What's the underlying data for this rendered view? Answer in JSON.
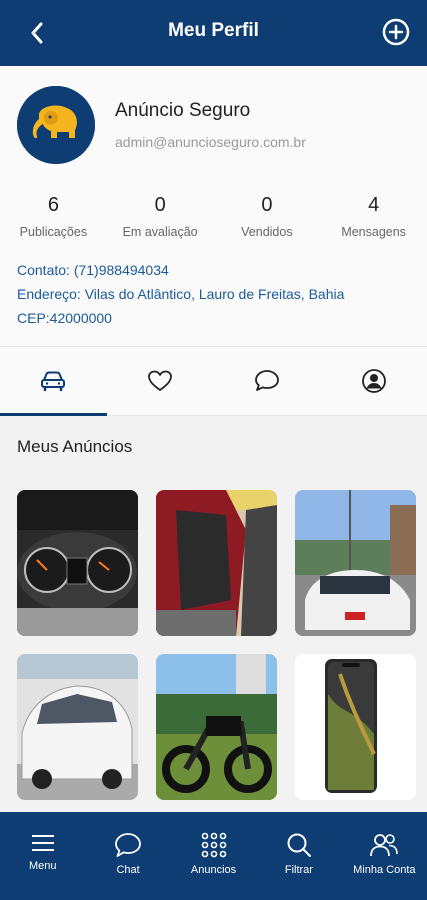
{
  "header": {
    "title": "Meu Perfil",
    "back_icon": "arrow-left-icon",
    "add_icon": "plus-circle-icon"
  },
  "profile": {
    "name": "Anúncio Seguro",
    "email": "admin@anuncioseguro.com.br",
    "stats": [
      {
        "value": "6",
        "label": "Publicações"
      },
      {
        "value": "0",
        "label": "Em avaliação"
      },
      {
        "value": "0",
        "label": "Vendidos"
      },
      {
        "value": "4",
        "label": "Mensagens"
      }
    ],
    "contact": "Contato: (71)988494034",
    "address": "Endereço: Vilas do Atlântico, Lauro de Freitas, Bahia",
    "cep": "CEP:42000000"
  },
  "tabs": [
    {
      "icon": "car-icon",
      "active": true
    },
    {
      "icon": "heart-icon",
      "active": false
    },
    {
      "icon": "chat-bubbles-icon",
      "active": false
    },
    {
      "icon": "user-circle-icon",
      "active": false
    }
  ],
  "section_title": "Meus Anúncios",
  "nav": [
    {
      "label": "Menu",
      "icon": "menu-icon"
    },
    {
      "label": "Chat",
      "icon": "chat-icon"
    },
    {
      "label": "Anuncios",
      "icon": "grid-icon"
    },
    {
      "label": "Filtrar",
      "icon": "search-icon"
    },
    {
      "label": "Minha Conta",
      "icon": "users-icon"
    }
  ],
  "colors": {
    "primary": "#0d3d73",
    "link": "#1b5a99",
    "brand_yellow": "#f5b51f"
  }
}
